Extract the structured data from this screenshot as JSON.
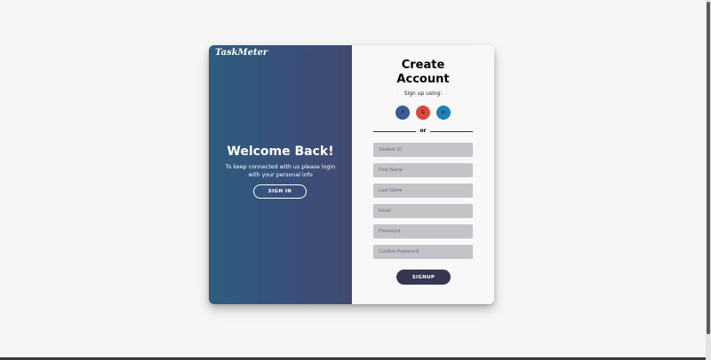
{
  "brand": {
    "logo": "TaskMeter"
  },
  "welcome_panel": {
    "title": "Welcome Back!",
    "subtitle": "To keep connected with us please login with your personal info",
    "signin_label": "SIGN IN"
  },
  "signup_panel": {
    "title_line1": "Create",
    "title_line2": "Account",
    "signup_using": "Sign up using:",
    "socials": [
      {
        "name": "facebook-icon",
        "glyph": "f",
        "color": "#3a5a98"
      },
      {
        "name": "google-plus-icon",
        "glyph": "G",
        "color": "#d8493d"
      },
      {
        "name": "linkedin-icon",
        "glyph": "in",
        "color": "#1d82b6"
      }
    ],
    "or_label": "or",
    "fields": {
      "student_id": "Student ID",
      "first_name": "First Name",
      "last_name": "Last Name",
      "email": "Email",
      "password": "Password",
      "confirm_password": "Confirm Password"
    },
    "signup_label": "SIGNUP"
  },
  "colors": {
    "gradient_start": "#2e5c7e",
    "gradient_end": "#424a72",
    "signup_button": "#363653",
    "input_bg": "#c3c3c8"
  }
}
